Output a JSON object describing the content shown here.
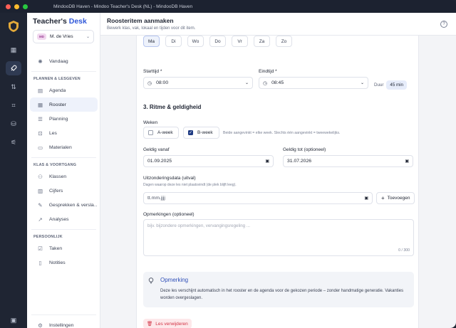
{
  "window": {
    "title": "MindooDB Haven - Mindoo Teacher's Desk (NL) - MindooDB Haven"
  },
  "brand": {
    "part1": "Teacher's ",
    "part2": "Desk"
  },
  "user": {
    "initials": "MD",
    "name": "M. de Vries"
  },
  "rail": [
    "grid-icon",
    "rocket-icon",
    "sync-icon",
    "scan-icon",
    "database-icon",
    "sliders-icon"
  ],
  "sidebar": {
    "today": "Vandaag",
    "section1": "PLANNEN & LESGEVEN",
    "items1": [
      "Agenda",
      "Rooster",
      "Planning",
      "Les",
      "Materialen"
    ],
    "section2": "KLAS & VOORTGANG",
    "items2": [
      "Klassen",
      "Cijfers",
      "Gesprekken & versla…",
      "Analyses"
    ],
    "section3": "PERSOONLIJK",
    "items3": [
      "Taken",
      "Notities"
    ],
    "settings": "Instellingen"
  },
  "header": {
    "title": "Roosteritem aanmaken",
    "subtitle": "Bewerk klas, vak, lokaal en tijden voor dit item."
  },
  "days": [
    "Ma",
    "Di",
    "Wo",
    "Do",
    "Vr",
    "Za",
    "Zo"
  ],
  "time": {
    "start_label": "Starttijd *",
    "start_value": "08:00",
    "end_label": "Eindtijd *",
    "end_value": "08:45",
    "duration_label": "Duur",
    "duration_value": "45 min"
  },
  "section3": {
    "title": "3. Ritme & geldigheid",
    "weeks_label": "Weken",
    "a_week": "A-week",
    "b_week": "B-week",
    "weeks_hint": "Beide aangevinkt = elke week. Slechts één aangevinkt = tweewekelijks.",
    "valid_from_label": "Geldig vanaf",
    "valid_from_value": "01.09.2025",
    "valid_to_label": "Geldig tot (optioneel)",
    "valid_to_value": "31.07.2026",
    "exclusion_label": "Uitzonderingsdata (uitval)",
    "exclusion_hint": "Dagen waarop deze les niet plaatsvindt (de plek blijft leeg).",
    "exclusion_placeholder": "tt.mm.jjjj",
    "add_button": "Toevoegen",
    "remarks_label": "Opmerkingen (optioneel)",
    "remarks_placeholder": "bijv. bijzondere opmerkingen, vervangingsregeling ...",
    "remarks_count": "0 / 300"
  },
  "note": {
    "title": "Opmerking",
    "body": "Deze les verschijnt automatisch in het rooster en de agenda voor de gekozen periode – zonder handmatige generatie. Vakanties worden overgeslagen."
  },
  "delete_button": "Les verwijderen",
  "colors": {
    "accent": "#2f57d9",
    "danger": "#d23446",
    "rail": "#1f2533"
  }
}
